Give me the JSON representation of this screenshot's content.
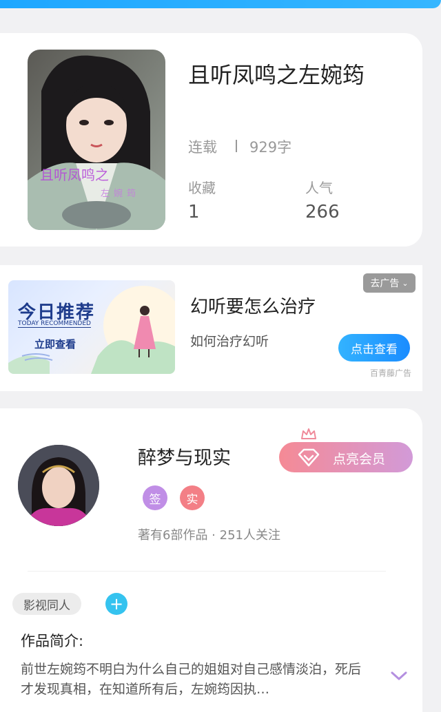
{
  "colors": {
    "accent_blue": "#33b3ff",
    "vip_gradient_start": "#f58a95",
    "vip_gradient_end": "#d29ad8",
    "add_tag": "#35c3ef"
  },
  "book": {
    "title": "且听凤鸣之左婉筠",
    "cover_text_main": "且听凤鸣之",
    "cover_text_sub": "左婉筠",
    "status": "连载",
    "word_count": "929字",
    "favorites_label": "收藏",
    "favorites_value": "1",
    "popularity_label": "人气",
    "popularity_value": "266"
  },
  "ad": {
    "banner_title": "今日推荐",
    "banner_subtitle": "TODAY RECOMMENDED",
    "banner_cta": "立即查看",
    "title": "幻听要怎么治疗",
    "description": "如何治疗幻听",
    "close_label": "去广告",
    "cta_label": "点击查看",
    "source": "百青藤广告"
  },
  "author": {
    "name": "醉梦与现实",
    "badges": [
      {
        "label": "签",
        "color": "#c08ee6"
      },
      {
        "label": "实",
        "color": "#f37f86"
      }
    ],
    "meta": "著有6部作品 · 251人关注",
    "vip_label": "点亮会员"
  },
  "tags": {
    "items": [
      "影视同人"
    ],
    "add_symbol": "+"
  },
  "intro": {
    "label": "作品简介:",
    "text": "前世左婉筠不明白为什么自己的姐姐对自己感情淡泊，死后才发现真相，在知道所有后，左婉筠因执…"
  }
}
